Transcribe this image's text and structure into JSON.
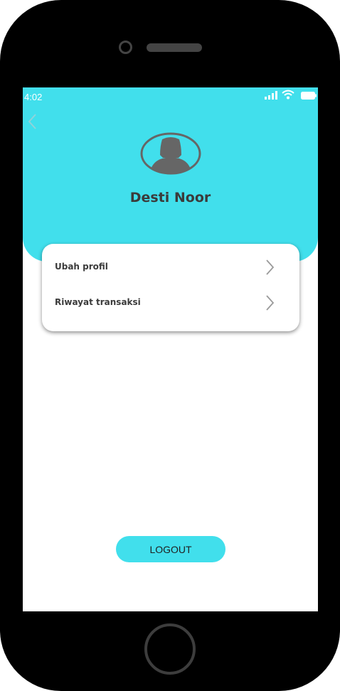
{
  "status_bar": {
    "time": "4:02",
    "icons": [
      "signal-icon",
      "wifi-icon",
      "battery-icon"
    ]
  },
  "header": {
    "back_icon": "chevron-left-icon",
    "avatar_icon": "user-avatar-icon",
    "user_name": "Desti Noor"
  },
  "menu": {
    "items": [
      {
        "label": "Ubah profil",
        "icon": "chevron-right-icon"
      },
      {
        "label": "Riwayat transaksi",
        "icon": "chevron-right-icon"
      }
    ]
  },
  "actions": {
    "logout_label": "LOGOUT"
  },
  "colors": {
    "accent": "#41dfec",
    "phone_frame": "#000000",
    "text_dark": "#3b3b3b",
    "icon_gray": "#666666"
  }
}
